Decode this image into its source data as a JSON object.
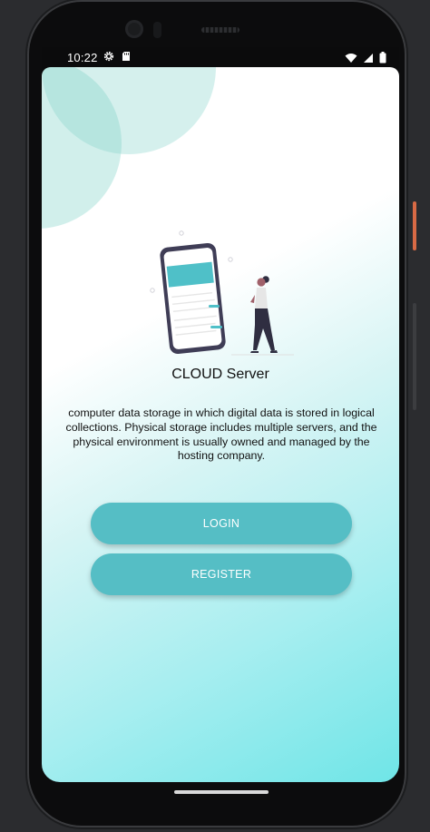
{
  "status_bar": {
    "time": "10:22",
    "left_icons": [
      "gear-icon",
      "sd-card-icon"
    ],
    "right_icons": [
      "wifi-icon",
      "signal-icon",
      "battery-icon"
    ]
  },
  "screen": {
    "title": "CLOUD Server",
    "description": "computer data storage in which digital data is stored in logical collections. Physical storage includes multiple servers, and the physical environment is usually owned and managed by the hosting company.",
    "buttons": {
      "login": "LOGIN",
      "register": "REGISTER"
    }
  },
  "colors": {
    "button": "#55bec5",
    "accent_teal": "#4fc0c8",
    "illustration_outline": "#3f3d56"
  }
}
